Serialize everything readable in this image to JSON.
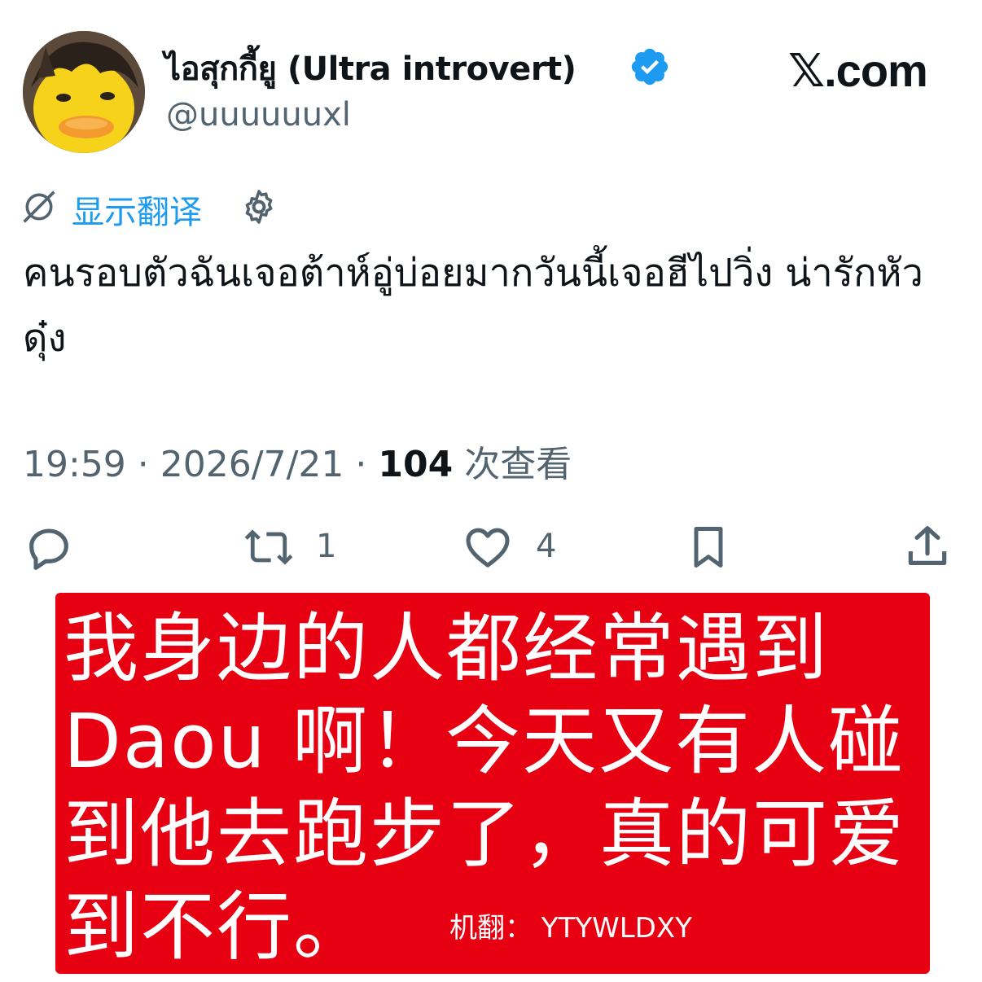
{
  "tweet": {
    "author": {
      "display_name": "ไอสุกกี้ยู (Ultra introvert)",
      "handle": "@uuuuuuxl",
      "verified": true
    },
    "brand": "𝕏.com",
    "translate": {
      "label": "显示翻译"
    },
    "text": "คนรอบตัวฉันเจอต้าห์อู่บ่อยมากวันนี้เจอฮีไปวิ่ง น่ารักหัวดุ๋ง",
    "meta": {
      "time": "19:59",
      "separator": " · ",
      "date": "2026/7/21",
      "views_count": "104",
      "views_label": " 次查看"
    },
    "actions": {
      "reply_icon": "reply-icon",
      "retweet_icon": "retweet-icon",
      "retweet_count": "1",
      "like_icon": "heart-icon",
      "like_count": "4",
      "bookmark_icon": "bookmark-icon",
      "share_icon": "share-icon"
    }
  },
  "overlay": {
    "text": "我身边的人都经常遇到Daou 啊！今天又有人碰到他去跑步了，真的可爱到不行。",
    "credit": "机翻：  YTYWLDXY",
    "background_color": "#e60012"
  },
  "colors": {
    "accent": "#1d9bf0",
    "muted": "#536471",
    "text": "#0f1419"
  }
}
